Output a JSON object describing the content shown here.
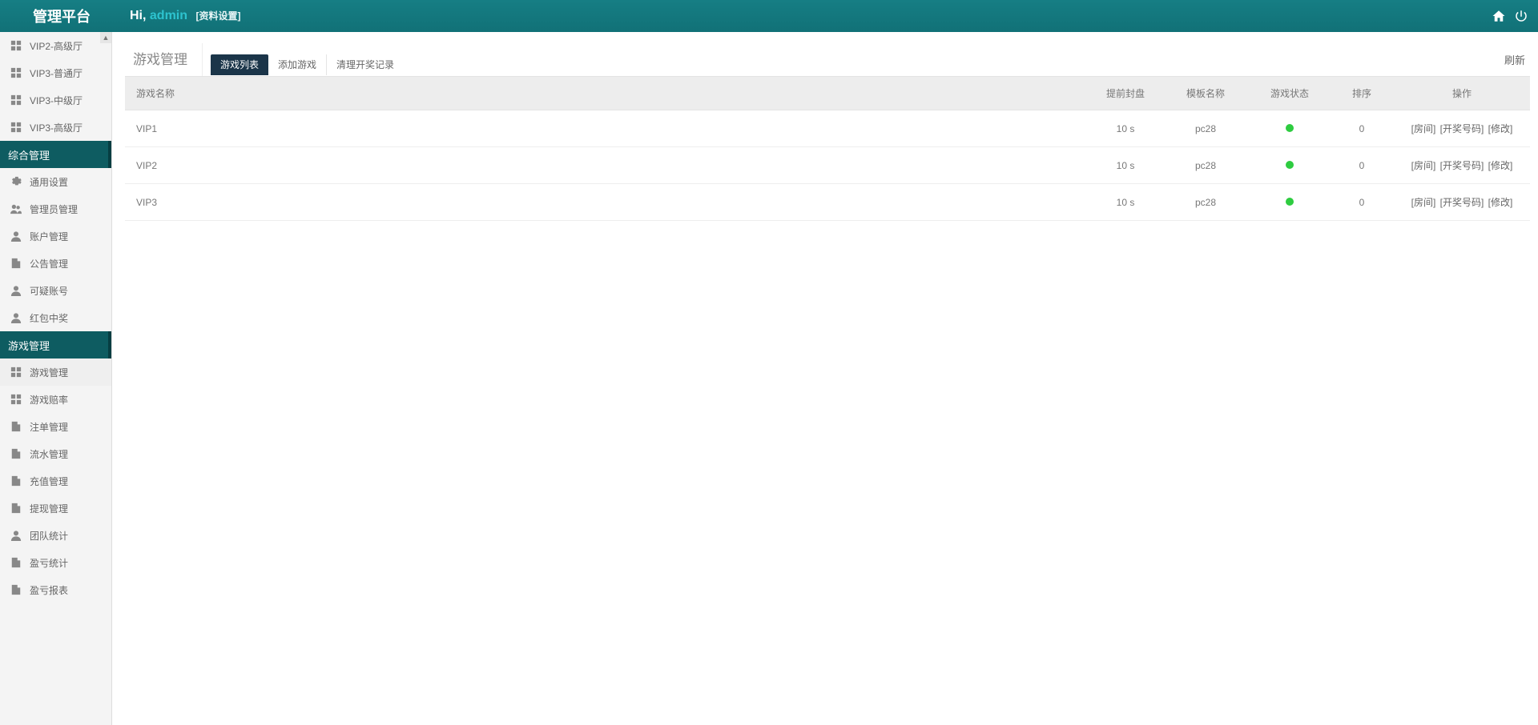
{
  "header": {
    "brand": "管理平台",
    "greeting_prefix": "Hi, ",
    "username": "admin",
    "sublink": "[资料设置]"
  },
  "sidebar_top_items": [
    {
      "label": "VIP2-高级厅",
      "icon": "grid"
    },
    {
      "label": "VIP3-普通厅",
      "icon": "grid"
    },
    {
      "label": "VIP3-中级厅",
      "icon": "grid"
    },
    {
      "label": "VIP3-高级厅",
      "icon": "grid"
    }
  ],
  "sidebar_cat_a": "综合管理",
  "sidebar_a_items": [
    {
      "label": "通用设置",
      "icon": "gear"
    },
    {
      "label": "管理员管理",
      "icon": "users"
    },
    {
      "label": "账户管理",
      "icon": "user"
    },
    {
      "label": "公告管理",
      "icon": "doc"
    },
    {
      "label": "可疑账号",
      "icon": "user"
    },
    {
      "label": "红包中奖",
      "icon": "user"
    }
  ],
  "sidebar_cat_b": "游戏管理",
  "sidebar_b_items": [
    {
      "label": "游戏管理",
      "icon": "grid",
      "active": true
    },
    {
      "label": "游戏赔率",
      "icon": "grid"
    },
    {
      "label": "注单管理",
      "icon": "doc"
    },
    {
      "label": "流水管理",
      "icon": "doc"
    },
    {
      "label": "充值管理",
      "icon": "doc"
    },
    {
      "label": "提现管理",
      "icon": "doc"
    },
    {
      "label": "团队统计",
      "icon": "user"
    },
    {
      "label": "盈亏统计",
      "icon": "doc"
    },
    {
      "label": "盈亏报表",
      "icon": "doc"
    }
  ],
  "page": {
    "title": "游戏管理",
    "tabs": [
      "游戏列表",
      "添加游戏",
      "清理开奖记录"
    ],
    "active_tab": 0,
    "refresh": "刷新"
  },
  "table": {
    "headers": [
      "游戏名称",
      "提前封盘",
      "模板名称",
      "游戏状态",
      "排序",
      "操作"
    ],
    "rows": [
      {
        "name": "VIP1",
        "close": "10 s",
        "tpl": "pc28",
        "state": "green",
        "sort": "0"
      },
      {
        "name": "VIP2",
        "close": "10 s",
        "tpl": "pc28",
        "state": "green",
        "sort": "0"
      },
      {
        "name": "VIP3",
        "close": "10 s",
        "tpl": "pc28",
        "state": "green",
        "sort": "0"
      }
    ],
    "op_labels": {
      "room": "[房间]",
      "num": "[开奖号码]",
      "edit": "[修改]"
    }
  }
}
